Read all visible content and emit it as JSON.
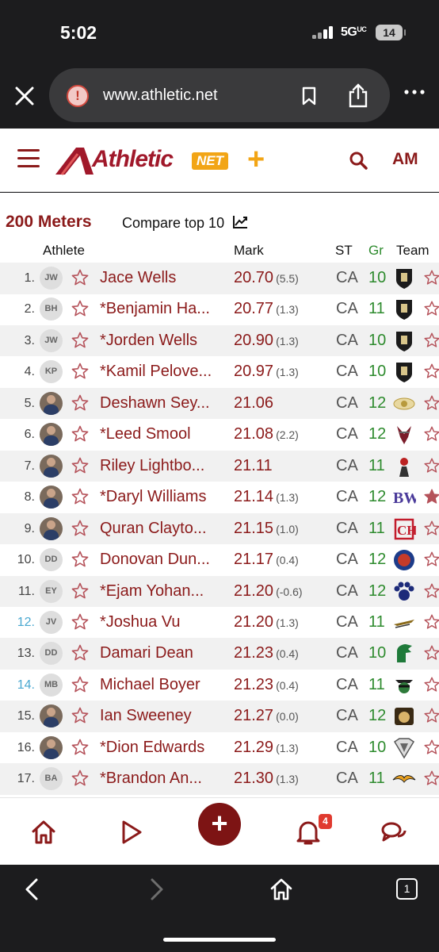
{
  "status_bar": {
    "time": "5:02",
    "network": "5G",
    "network_sub": "UC",
    "battery": "14"
  },
  "browser": {
    "url": "www.athletic.net",
    "warning_glyph": "!",
    "tab_count": "1"
  },
  "site": {
    "logo_word": "Athletic",
    "logo_net": "NET",
    "logo_plus": "+",
    "user_initials": "AM"
  },
  "event": {
    "title": "200 Meters",
    "compare_label": "Compare top 10"
  },
  "columns": {
    "athlete": "Athlete",
    "mark": "Mark",
    "st": "ST",
    "gr": "Gr",
    "team": "Team"
  },
  "results": [
    {
      "rank": "1.",
      "initials": "JW",
      "photo": false,
      "name": "Jace Wells",
      "mark": "20.70",
      "wind": "(5.5)",
      "st": "CA",
      "gr": "10",
      "team_logo": "knight-shield-logo",
      "tie": false,
      "favorited": false
    },
    {
      "rank": "2.",
      "initials": "BH",
      "photo": false,
      "name": "*Benjamin Ha...",
      "mark": "20.77",
      "wind": "(1.3)",
      "st": "CA",
      "gr": "11",
      "team_logo": "knight-shield-logo",
      "tie": false,
      "favorited": false
    },
    {
      "rank": "3.",
      "initials": "JW",
      "photo": false,
      "name": "*Jorden Wells",
      "mark": "20.90",
      "wind": "(1.3)",
      "st": "CA",
      "gr": "10",
      "team_logo": "knight-shield-logo",
      "tie": false,
      "favorited": false
    },
    {
      "rank": "4.",
      "initials": "KP",
      "photo": false,
      "name": "*Kamil Pelove...",
      "mark": "20.97",
      "wind": "(1.3)",
      "st": "CA",
      "gr": "10",
      "team_logo": "knight-shield-logo",
      "tie": false,
      "favorited": false
    },
    {
      "rank": "5.",
      "initials": "",
      "photo": true,
      "name": "Deshawn Sey...",
      "mark": "21.06",
      "wind": "",
      "st": "CA",
      "gr": "12",
      "team_logo": "gold-crest-logo",
      "tie": false,
      "favorited": false
    },
    {
      "rank": "6.",
      "initials": "",
      "photo": true,
      "name": "*Leed Smool",
      "mark": "21.08",
      "wind": "(2.2)",
      "st": "CA",
      "gr": "12",
      "team_logo": "viking-logo",
      "tie": false,
      "favorited": false
    },
    {
      "rank": "7.",
      "initials": "",
      "photo": true,
      "name": "Riley Lightbo...",
      "mark": "21.11",
      "wind": "",
      "st": "CA",
      "gr": "11",
      "team_logo": "mascot-logo",
      "tie": false,
      "favorited": false
    },
    {
      "rank": "8.",
      "initials": "",
      "photo": true,
      "name": "*Daryl Williams",
      "mark": "21.14",
      "wind": "(1.3)",
      "st": "CA",
      "gr": "12",
      "team_logo": "bw-letters-logo",
      "tie": false,
      "favorited": true
    },
    {
      "rank": "9.",
      "initials": "",
      "photo": true,
      "name": "Quran Clayto...",
      "mark": "21.15",
      "wind": "(1.0)",
      "st": "CA",
      "gr": "11",
      "team_logo": "ch-letters-logo",
      "tie": false,
      "favorited": false
    },
    {
      "rank": "10.",
      "initials": "DD",
      "photo": false,
      "name": "Donovan Dun...",
      "mark": "21.17",
      "wind": "(0.4)",
      "st": "CA",
      "gr": "12",
      "team_logo": "blue-shield-logo",
      "tie": false,
      "favorited": false
    },
    {
      "rank": "11.",
      "initials": "EY",
      "photo": false,
      "name": "*Ejam Yohan...",
      "mark": "21.20",
      "wind": "(-0.6)",
      "st": "CA",
      "gr": "12",
      "team_logo": "paw-logo",
      "tie": false,
      "favorited": false
    },
    {
      "rank": "12.",
      "initials": "JV",
      "photo": false,
      "name": "*Joshua Vu",
      "mark": "21.20",
      "wind": "(1.3)",
      "st": "CA",
      "gr": "11",
      "team_logo": "wing-script-logo",
      "tie": true,
      "favorited": false
    },
    {
      "rank": "13.",
      "initials": "DD",
      "photo": false,
      "name": "Damari Dean",
      "mark": "21.23",
      "wind": "(0.4)",
      "st": "CA",
      "gr": "10",
      "team_logo": "spartan-logo",
      "tie": false,
      "favorited": false
    },
    {
      "rank": "14.",
      "initials": "MB",
      "photo": false,
      "name": "Michael Boyer",
      "mark": "21.23",
      "wind": "(0.4)",
      "st": "CA",
      "gr": "11",
      "team_logo": "bandit-logo",
      "tie": true,
      "favorited": false
    },
    {
      "rank": "15.",
      "initials": "",
      "photo": true,
      "name": "Ian Sweeney",
      "mark": "21.27",
      "wind": "(0.0)",
      "st": "CA",
      "gr": "12",
      "team_logo": "bulldog-logo",
      "tie": false,
      "favorited": false
    },
    {
      "rank": "16.",
      "initials": "",
      "photo": true,
      "name": "*Dion Edwards",
      "mark": "21.29",
      "wind": "(1.3)",
      "st": "CA",
      "gr": "10",
      "team_logo": "superman-shield-logo",
      "tie": false,
      "favorited": false
    },
    {
      "rank": "17.",
      "initials": "BA",
      "photo": false,
      "name": "*Brandon An...",
      "mark": "21.30",
      "wind": "(1.3)",
      "st": "CA",
      "gr": "11",
      "team_logo": "eagle-logo",
      "tie": false,
      "favorited": false
    }
  ],
  "app_nav": {
    "notification_count": "4",
    "fab_label": "+"
  },
  "colors": {
    "brand": "#8b1a1a",
    "accent": "#f2a516",
    "grade": "#2e8b2e",
    "tie_rank": "#4aa8d0"
  }
}
